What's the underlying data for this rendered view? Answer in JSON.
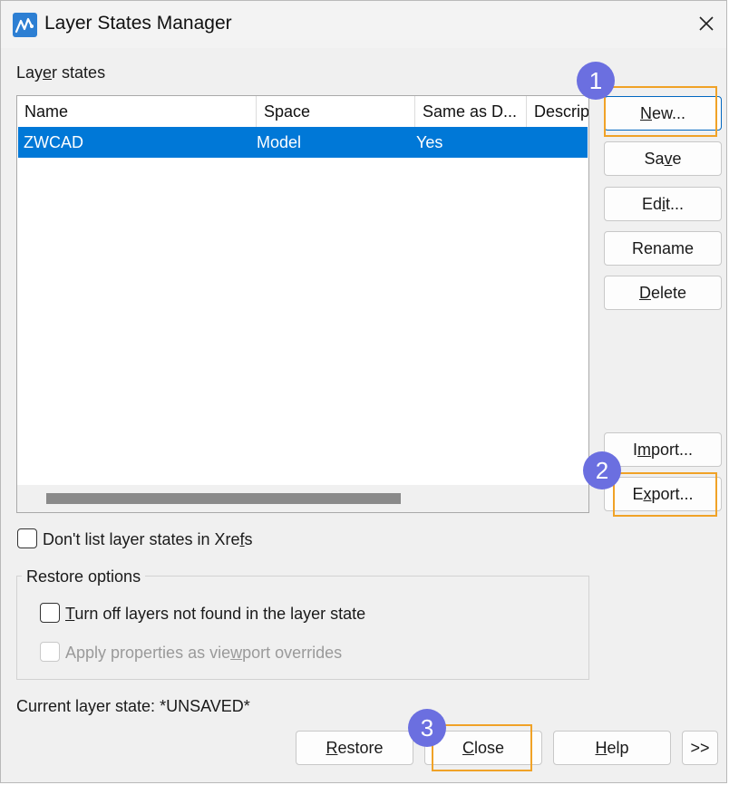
{
  "window": {
    "title": "Layer States Manager"
  },
  "layer_states": {
    "label_pre": "Lay",
    "label_ul": "e",
    "label_post": "r states",
    "columns": [
      "Name",
      "Space",
      "Same as D...",
      "Descrip"
    ],
    "rows": [
      {
        "name": "ZWCAD",
        "space": "Model",
        "same": "Yes",
        "description": ""
      }
    ]
  },
  "side_buttons": {
    "new": {
      "ul": "N",
      "rest": "ew..."
    },
    "save": {
      "pre": "Sa",
      "ul": "v",
      "post": "e"
    },
    "edit": {
      "pre": "Ed",
      "ul": "i",
      "post": "t..."
    },
    "rename": {
      "label": "Rename"
    },
    "delete": {
      "ul": "D",
      "rest": "elete"
    },
    "import": {
      "pre": "I",
      "ul": "m",
      "post": "port..."
    },
    "export": {
      "pre": "E",
      "ul": "x",
      "post": "port..."
    }
  },
  "options": {
    "xrefs": {
      "pre": "Don't list layer states in Xre",
      "ul": "f",
      "post": "s",
      "checked": false
    },
    "restore_title": "Restore options",
    "turn_off": {
      "ul": "T",
      "rest": "urn off layers not found in the layer state",
      "checked": false
    },
    "viewport": {
      "pre": "Apply properties as vie",
      "ul": "w",
      "post": "port overrides",
      "checked": false,
      "enabled": false
    }
  },
  "status": {
    "label": "Current layer state:",
    "value": "*UNSAVED*"
  },
  "bottom_buttons": {
    "restore": {
      "ul": "R",
      "rest": "estore"
    },
    "close": {
      "ul": "C",
      "rest": "lose"
    },
    "help": {
      "ul": "H",
      "rest": "elp"
    },
    "more": ">>"
  },
  "callouts": [
    "1",
    "2",
    "3"
  ],
  "colors": {
    "selection": "#0078d7",
    "highlight": "#f0a227",
    "badge": "#6b6fe0"
  }
}
